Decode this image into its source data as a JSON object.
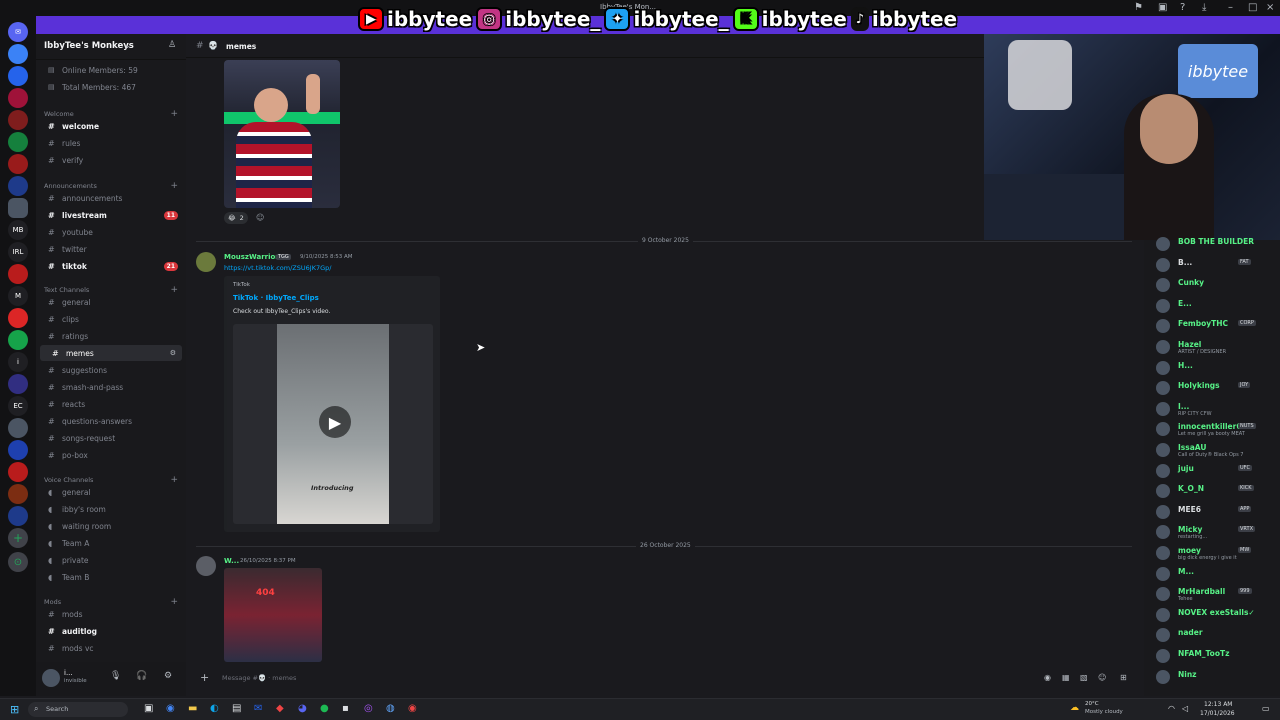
{
  "window": {
    "title": "IbbyTee's Mon..."
  },
  "social": [
    {
      "platform": "youtube",
      "icon": "youtube-icon",
      "handle": "ibbytee",
      "color": "#ff0000"
    },
    {
      "platform": "instagram",
      "icon": "instagram-icon",
      "handle": "ibbytee_",
      "color": "#c13584"
    },
    {
      "platform": "twitter",
      "icon": "twitter-icon",
      "handle": "ibbytee_",
      "color": "#1da1f2"
    },
    {
      "platform": "kick",
      "icon": "kick-icon",
      "handle": "ibbytee",
      "color": "#53fc18"
    },
    {
      "platform": "tiktok",
      "icon": "tiktok-icon",
      "handle": "ibbytee",
      "color": "#111111"
    }
  ],
  "rail": {
    "labels": [
      "MB",
      "IRL",
      "EC"
    ]
  },
  "server": {
    "name": "IbbyTee's Monkeys"
  },
  "stats": {
    "online": "Online Members: 59",
    "total": "Total Members: 467"
  },
  "categories": [
    {
      "name": "Welcome",
      "channels": [
        {
          "label": "welcome",
          "state": "unread"
        },
        {
          "label": "rules"
        },
        {
          "label": "verify"
        }
      ]
    },
    {
      "name": "Announcements",
      "channels": [
        {
          "label": "announcements"
        },
        {
          "label": "livestream",
          "state": "unread",
          "badge": "11"
        },
        {
          "label": "youtube"
        },
        {
          "label": "twitter"
        },
        {
          "label": "tiktok",
          "state": "unread",
          "badge": "21"
        }
      ]
    },
    {
      "name": "Text Channels",
      "channels": [
        {
          "label": "general"
        },
        {
          "label": "clips"
        },
        {
          "label": "ratings"
        },
        {
          "label": "memes",
          "state": "selected"
        },
        {
          "label": "suggestions"
        },
        {
          "label": "smash-and-pass"
        },
        {
          "label": "reacts"
        },
        {
          "label": "questions-answers"
        },
        {
          "label": "songs-request"
        },
        {
          "label": "po-box"
        }
      ]
    },
    {
      "name": "Voice Channels",
      "channels": [
        {
          "label": "general"
        },
        {
          "label": "ibby's room"
        },
        {
          "label": "waiting room"
        },
        {
          "label": "Team A"
        },
        {
          "label": "private"
        },
        {
          "label": "Team B"
        }
      ]
    },
    {
      "name": "Mods",
      "channels": [
        {
          "label": "mods"
        },
        {
          "label": "auditlog",
          "state": "unread"
        },
        {
          "label": "mods vc"
        }
      ]
    }
  ],
  "user": {
    "name": "i...",
    "status": "invisible"
  },
  "chat": {
    "channel": "memes",
    "reactions": [
      {
        "emoji": "😂",
        "count": "2"
      }
    ],
    "dividers": [
      "9 October 2025",
      "26 October 2025"
    ],
    "message1": {
      "author": "MouszWarrior",
      "tag": "TGG",
      "time": "9/10/2025 8:53 AM",
      "link": "https://vt.tiktok.com/ZSU6JK7Gp/",
      "embed": {
        "provider": "TikTok",
        "title": "TikTok · IbbyTee_Clips",
        "desc": "Check out IbbyTee_Clips's video.",
        "video_caption": "Introducing"
      }
    },
    "message2": {
      "author": "W...",
      "time": "26/10/2025 8:37 PM",
      "image_text": "404"
    },
    "composer_placeholder": "Message #💀 · memes"
  },
  "members": [
    {
      "name": "BOB THE BUILDER",
      "color": "#57f287"
    },
    {
      "name": "B...",
      "tag": "FAT",
      "color": "#dbdee1"
    },
    {
      "name": "Cunky",
      "color": "#57f287"
    },
    {
      "name": "E...",
      "color": "#57f287"
    },
    {
      "name": "FemboyTHC",
      "tag": "CORP",
      "color": "#57f287"
    },
    {
      "name": "Hazel",
      "sub": "ARTIST / DESIGNER",
      "color": "#57f287"
    },
    {
      "name": "H...",
      "color": "#57f287"
    },
    {
      "name": "Holykings",
      "tag": "JOY",
      "color": "#57f287"
    },
    {
      "name": "I...",
      "sub": "RIP CITY CFW",
      "color": "#57f287"
    },
    {
      "name": "innocentkiller69...",
      "tag": "NUTS",
      "sub": "Let me grill ya booty MEAT",
      "color": "#57f287"
    },
    {
      "name": "IssaAU",
      "sub": "Call of Duty® Black Ops 7",
      "color": "#57f287"
    },
    {
      "name": "juju",
      "tag": "UFC",
      "color": "#57f287"
    },
    {
      "name": "K_O_N",
      "tag": "KICK",
      "color": "#57f287"
    },
    {
      "name": "MEE6",
      "tag": "APP",
      "color": "#dbdee1"
    },
    {
      "name": "Micky",
      "tag": "VRTX",
      "sub": "restarting...",
      "color": "#57f287"
    },
    {
      "name": "moey",
      "tag": "MW",
      "sub": "big dick energy i give it",
      "color": "#57f287"
    },
    {
      "name": "M...",
      "color": "#57f287"
    },
    {
      "name": "MrHardball",
      "tag": "999",
      "sub": "Tehee",
      "color": "#57f287"
    },
    {
      "name": "NOVEX exeStalls✓",
      "color": "#57f287"
    },
    {
      "name": "nader",
      "color": "#57f287"
    },
    {
      "name": "NFAM_TooTz",
      "color": "#57f287"
    },
    {
      "name": "Ninz",
      "color": "#57f287"
    }
  ],
  "taskbar": {
    "search": "Search",
    "weather_temp": "20°C",
    "weather": "Mostly cloudy",
    "time": "12:13 AM",
    "date": "17/01/2026"
  },
  "colors": {
    "accent": "#5865f2",
    "overlay_bar": "#5a31d8",
    "online": "#23a55a",
    "mention": "#da373c"
  }
}
